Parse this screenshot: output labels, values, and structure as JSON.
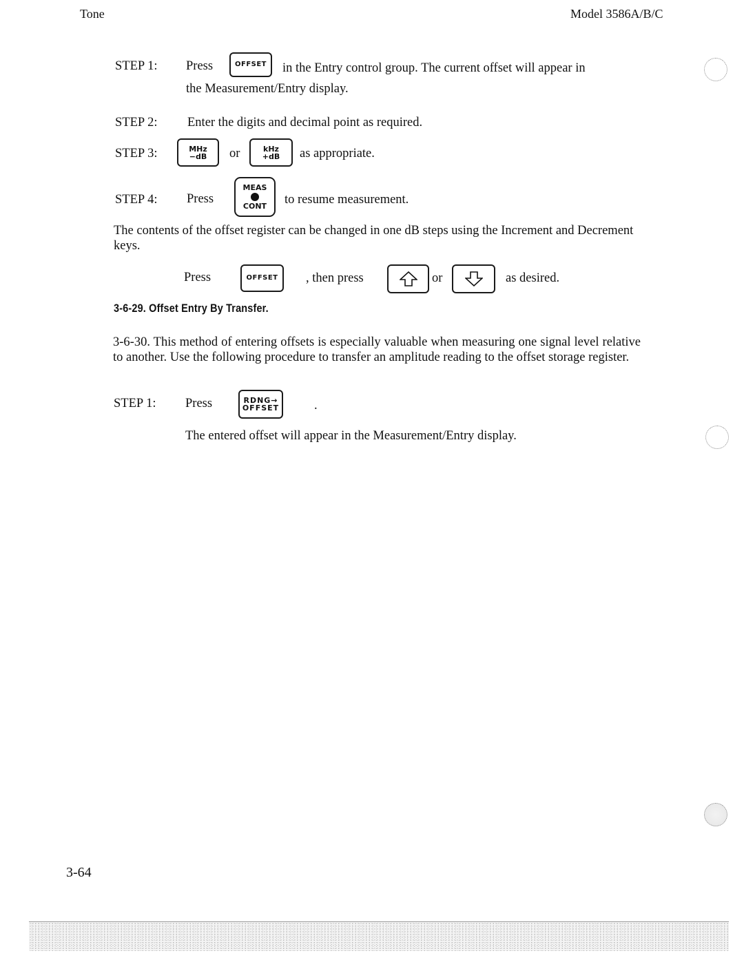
{
  "header": {
    "left": "Tone",
    "right": "Model 3586A/B/C"
  },
  "steps_a": [
    {
      "label": "STEP 1:",
      "pre": "Press",
      "key": "OFFSET",
      "text_line1": "in the Entry control group. The current offset will appear in",
      "text_line2": "the Measurement/Entry display."
    },
    {
      "label": "STEP 2:",
      "text": "Enter the digits and decimal point as required."
    },
    {
      "label": "STEP 3:",
      "key1": {
        "top": "MHz",
        "bottom": "−dB"
      },
      "or": "or",
      "key2": {
        "top": "kHz",
        "bottom": "+dB"
      },
      "text": "as appropriate."
    },
    {
      "label": "STEP 4:",
      "pre": "Press",
      "key": {
        "top": "MEAS",
        "bottom": "CONT"
      },
      "text": "to resume measurement."
    }
  ],
  "paragraph_increment": "The contents of the offset register can be changed in one dB steps using the Increment and Decrement keys.",
  "increment_line": {
    "pre": "Press",
    "key": "OFFSET",
    "then": ", then press",
    "up_icon": "up-arrow-icon",
    "or": "or",
    "down_icon": "down-arrow-icon",
    "post": "as desired."
  },
  "section_heading": "3-6-29.  Offset Entry By Transfer.",
  "paragraph_transfer": "3-6-30. This method of entering offsets is especially valuable when measuring one signal level relative to another. Use the following procedure to transfer an amplitude reading to the offset storage register.",
  "steps_b": [
    {
      "label": "STEP 1:",
      "pre": "Press",
      "key": {
        "top": "RDNG→",
        "bottom": "OFFSET"
      },
      "post": ".",
      "note": "The entered offset will appear in the Measurement/Entry display."
    }
  ],
  "page_number": "3-64"
}
